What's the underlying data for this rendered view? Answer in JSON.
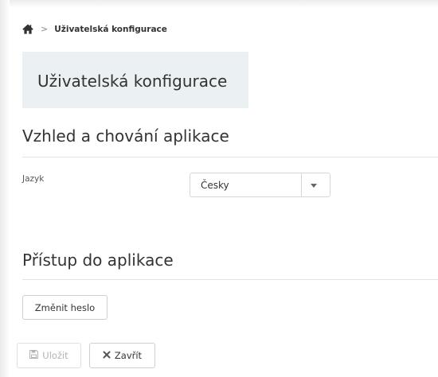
{
  "breadcrumb": {
    "home_icon": "home-icon",
    "separator": ">",
    "current": "Uživatelská konfigurace"
  },
  "page": {
    "title": "Uživatelská konfigurace"
  },
  "appearance": {
    "title": "Vzhled a chování aplikace",
    "language_label": "Jazyk",
    "language_value": "Česky"
  },
  "access": {
    "title": "Přístup do aplikace",
    "change_password_label": "Změnit heslo"
  },
  "actions": {
    "save_label": "Uložit",
    "save_icon": "floppy-disk-icon",
    "close_label": "Zavřít",
    "close_icon": "close-icon"
  },
  "colors": {
    "title_box_bg": "#ebf0f3",
    "text": "#333333",
    "disabled_text": "#b3b3b3"
  }
}
